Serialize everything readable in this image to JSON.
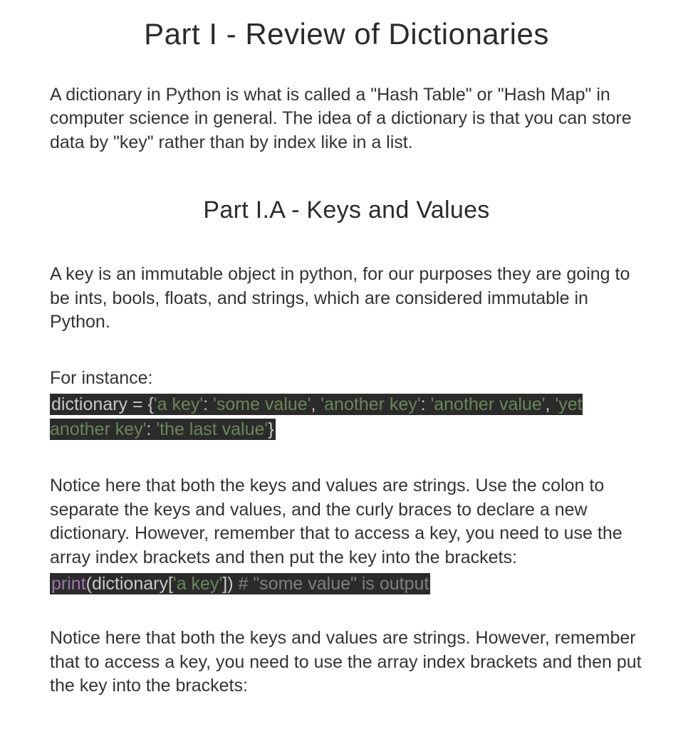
{
  "title_main": "Part I - Review of Dictionaries",
  "para1": "A dictionary in Python is what is called a \"Hash Table\" or \"Hash Map\" in computer science in general.  The idea of a dictionary is that you can store data by \"key\" rather than by index like in a list.",
  "title_sub": "Part I.A - Keys and Values",
  "para2": "A key is an immutable object in python, for our purposes they are going to be ints, bools, floats, and strings, which are considered immutable in Python.",
  "para3_lead": "For instance:",
  "code1": {
    "t_dict": "dictionary",
    "t_eq": " = ",
    "t_open": "{",
    "t_k1": "'a key'",
    "t_c1": ": ",
    "t_v1": "'some value'",
    "t_s1": ", ",
    "t_k2": "'another key'",
    "t_c2": ": ",
    "t_v2": "'another value'",
    "t_s2": ", ",
    "t_k3": "'yet another key'",
    "t_c3": ": ",
    "t_v3": "'the last value'",
    "t_close": "}"
  },
  "para4": "Notice here that both the keys and values are strings.  Use the colon to separate the keys and values, and the curly braces to declare a new dictionary.  However, remember that to access a key, you need to use the array index brackets and then put the key into the brackets:",
  "code2": {
    "t_print": "print",
    "t_paren_o": "(",
    "t_dict": "dictionary",
    "t_brk_o": "[",
    "t_key": "'a key'",
    "t_brk_c": "]",
    "t_paren_c": ")",
    "t_comment": " #  \"some value\" is output"
  },
  "para5": "Notice here that both the keys and values are strings.  However, remember that to access a key, you need to use the array index brackets and then put the key into the brackets:"
}
